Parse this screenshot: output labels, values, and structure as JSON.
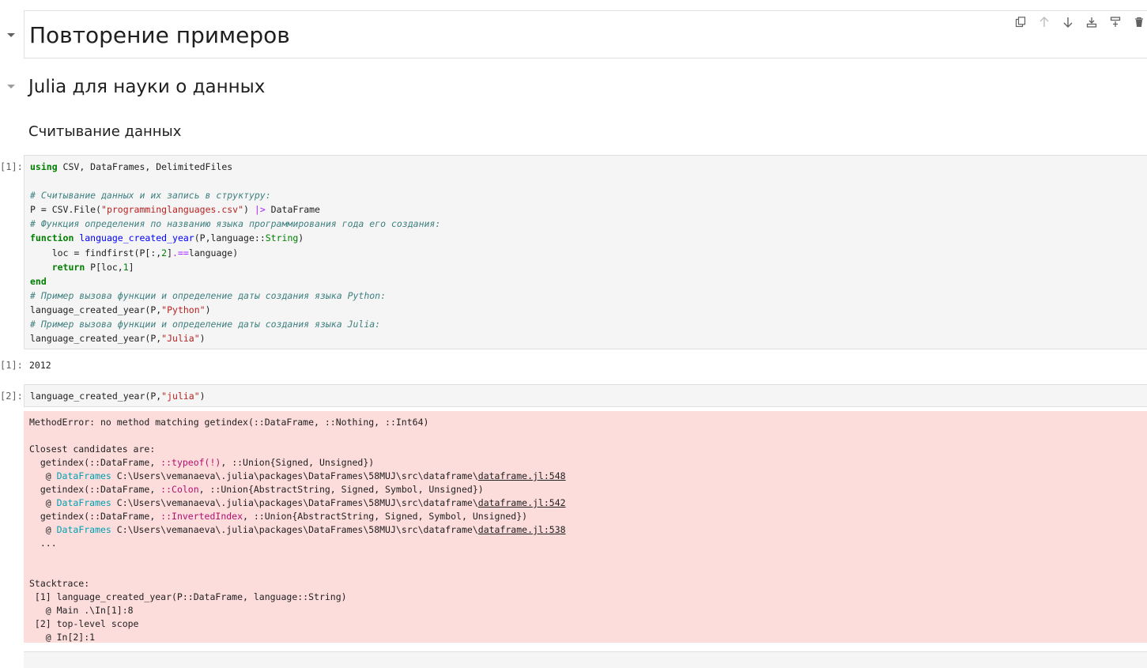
{
  "headings": {
    "h1": "Повторение примеров",
    "h2": "Julia для науки о данных",
    "h3": "Считывание данных"
  },
  "toolbar": [
    {
      "name": "duplicate-icon"
    },
    {
      "name": "move-up-icon"
    },
    {
      "name": "move-down-icon"
    },
    {
      "name": "insert-above-icon"
    },
    {
      "name": "insert-below-icon"
    },
    {
      "name": "delete-icon"
    }
  ],
  "cells": {
    "cell1": {
      "prompt": "[1]:",
      "output_prompt": "[1]:",
      "output": "2012"
    },
    "cell2": {
      "prompt": "[2]:"
    }
  },
  "code1": {
    "l1a": "using",
    "l1b": " CSV, DataFrames, DelimitedFiles",
    "l3": "# Считывание данных и их запись в структуру:",
    "l4a": "P = CSV.File(",
    "l4b": "\"programminglanguages.csv\"",
    "l4c": ") ",
    "l4d": "|>",
    "l4e": " DataFrame",
    "l5": "# Функция определения по названию языка программирования года его создания:",
    "l6a": "function",
    "l6b": " ",
    "l6c": "language_created_year",
    "l6d": "(P,language::",
    "l6e": "String",
    "l6f": ")",
    "l7a": "    loc = findfirst(P[:,",
    "l7b": "2",
    "l7c": "]",
    "l7d": ".==",
    "l7e": "language)",
    "l8a": "    ",
    "l8b": "return",
    "l8c": " P[loc,",
    "l8d": "1",
    "l8e": "]",
    "l9": "end",
    "l10": "# Пример вызова функции и определение даты создания языка Python:",
    "l11a": "language_created_year(P,",
    "l11b": "\"Python\"",
    "l11c": ")",
    "l12": "# Пример вызова функции и определение даты создания языка Julia:",
    "l13a": "language_created_year(P,",
    "l13b": "\"Julia\"",
    "l13c": ")"
  },
  "code2": {
    "a": "language_created_year(P,",
    "b": "\"julia\"",
    "c": ")"
  },
  "error": {
    "e1": "MethodError: no method matching getindex(::DataFrame, ::Nothing, ::Int64)",
    "e3": "Closest candidates are:",
    "e4a": "  getindex(::DataFrame, ",
    "e4b": "::typeof(!)",
    "e4c": ", ::Union{Signed, Unsigned})",
    "e5a": "   @ ",
    "e5b": "DataFrames",
    "e5c": " C:\\Users\\vemanaeva\\.julia\\packages\\DataFrames\\58MUJ\\src\\dataframe\\",
    "e5d": "dataframe.jl:548",
    "e6a": "  getindex(::DataFrame, ",
    "e6b": "::Colon",
    "e6c": ", ::Union{AbstractString, Signed, Symbol, Unsigned})",
    "e7a": "   @ ",
    "e7b": "DataFrames",
    "e7c": " C:\\Users\\vemanaeva\\.julia\\packages\\DataFrames\\58MUJ\\src\\dataframe\\",
    "e7d": "dataframe.jl:542",
    "e8a": "  getindex(::DataFrame, ",
    "e8b": "::InvertedIndex",
    "e8c": ", ::Union{AbstractString, Signed, Symbol, Unsigned})",
    "e9a": "   @ ",
    "e9b": "DataFrames",
    "e9c": " C:\\Users\\vemanaeva\\.julia\\packages\\DataFrames\\58MUJ\\src\\dataframe\\",
    "e9d": "dataframe.jl:538",
    "e10": "  ...",
    "e13": "Stacktrace:",
    "e14": " [1] language_created_year(P::DataFrame, language::String)",
    "e15": "   @ Main .\\In[1]:8",
    "e16": " [2] top-level scope",
    "e17": "   @ In[2]:1"
  }
}
